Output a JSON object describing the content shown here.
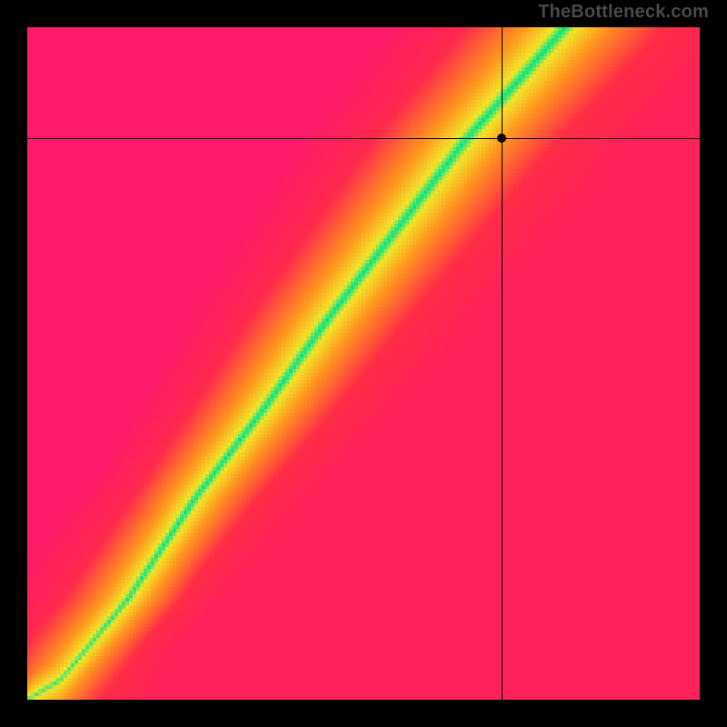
{
  "watermark": "TheBottleneck.com",
  "chart_data": {
    "type": "heatmap",
    "title": "",
    "xlabel": "",
    "ylabel": "",
    "x_range": [
      0,
      100
    ],
    "y_range": [
      0,
      100
    ],
    "crosshair": {
      "x": 70.5,
      "y": 83.5
    },
    "point": {
      "x": 70.5,
      "y": 83.5
    },
    "ridge_curve_description": "Green optimal band curving from bottom-left corner to upper area, roughly following y ≈ f(x) where band passes through (5,3), (25,30), (40,50), (55,70), (70,90), (80,100). Color transitions: red (far from ridge) → orange → yellow → green (on ridge).",
    "ridge_samples": [
      {
        "x": 0,
        "y": 0
      },
      {
        "x": 5,
        "y": 3
      },
      {
        "x": 15,
        "y": 15
      },
      {
        "x": 25,
        "y": 30
      },
      {
        "x": 35,
        "y": 43
      },
      {
        "x": 45,
        "y": 57
      },
      {
        "x": 55,
        "y": 70
      },
      {
        "x": 65,
        "y": 83
      },
      {
        "x": 73,
        "y": 92
      },
      {
        "x": 80,
        "y": 100
      }
    ],
    "colors": {
      "ridge": "#00e589",
      "near": "#f2e52a",
      "mid": "#ff9a1f",
      "far": "#ff2a47",
      "far2": "#ff1a5a"
    },
    "grid": false,
    "legend": false
  }
}
